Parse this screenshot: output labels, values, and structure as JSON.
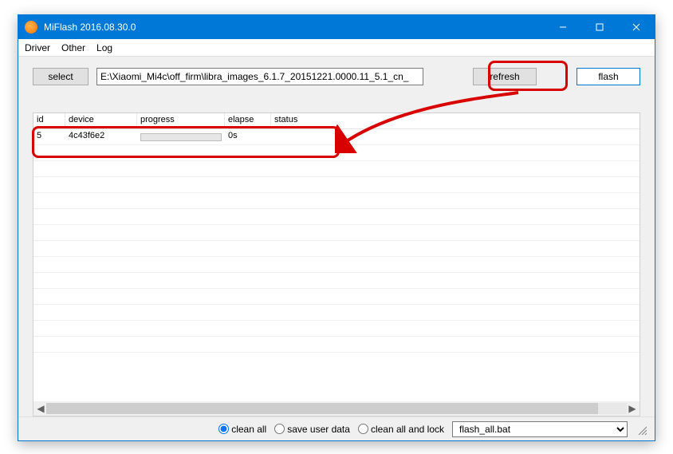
{
  "window": {
    "title": "MiFlash 2016.08.30.0"
  },
  "menu": {
    "driver": "Driver",
    "other": "Other",
    "log": "Log"
  },
  "toolbar": {
    "select_label": "select",
    "path_value": "E:\\Xiaomi_Mi4c\\off_firm\\libra_images_6.1.7_20151221.0000.11_5.1_cn_",
    "refresh_label": "refresh",
    "flash_label": "flash"
  },
  "table": {
    "headers": {
      "id": "id",
      "device": "device",
      "progress": "progress",
      "elapse": "elapse",
      "status": "status"
    },
    "rows": [
      {
        "id": "5",
        "device": "4c43f6e2",
        "progress": 0,
        "elapse": "0s",
        "status": ""
      }
    ]
  },
  "bottom": {
    "opt_clean_all": "clean all",
    "opt_save_user": "save user data",
    "opt_clean_lock": "clean all and lock",
    "selected": "clean_all",
    "bat_file": "flash_all.bat"
  }
}
